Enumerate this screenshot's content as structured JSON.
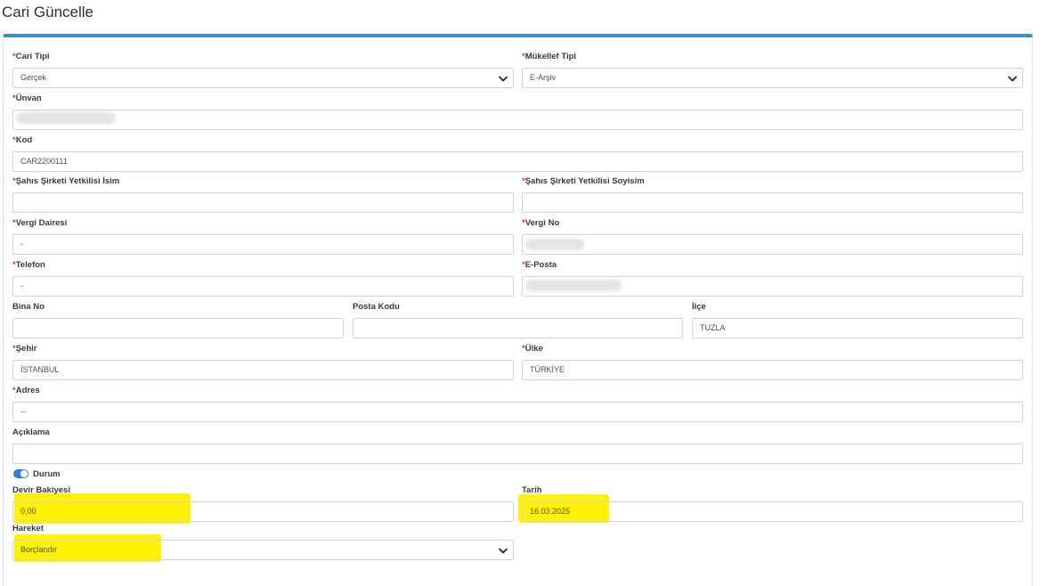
{
  "page": {
    "title": "Cari Güncelle"
  },
  "required_marker": "*",
  "form": {
    "cari_tipi": {
      "label": "Cari Tipi",
      "value": "Gerçek"
    },
    "mukellef_tipi": {
      "label": "Mükellef Tipi",
      "value": "E-Arşiv"
    },
    "unvan": {
      "label": "Ünvan",
      "value": ""
    },
    "kod": {
      "label": "Kod",
      "value": "CAR2200111"
    },
    "yetkili_isim": {
      "label": "Şahıs Şirketi Yetkilisi İsim",
      "value": ""
    },
    "yetkili_soyisim": {
      "label": "Şahıs Şirketi Yetkilisi Soyisim",
      "value": ""
    },
    "vergi_dairesi": {
      "label": "Vergi Dairesi",
      "value": "-"
    },
    "vergi_no": {
      "label": "Vergi No",
      "value": ""
    },
    "telefon": {
      "label": "Telefon",
      "value": "-"
    },
    "eposta": {
      "label": "E-Posta",
      "value": ""
    },
    "bina_no": {
      "label": "Bina No",
      "value": ""
    },
    "posta_kodu": {
      "label": "Posta Kodu",
      "value": ""
    },
    "ilce": {
      "label": "İlçe",
      "value": "TUZLA"
    },
    "sehir": {
      "label": "Şehir",
      "value": "İSTANBUL"
    },
    "ulke": {
      "label": "Ülke",
      "value": "TÜRKİYE"
    },
    "adres": {
      "label": "Adres",
      "value": "--"
    },
    "aciklama": {
      "label": "Açıklama",
      "value": ""
    },
    "durum": {
      "label": "Durum",
      "checked": true
    },
    "devir_bakiyesi": {
      "label": "Devir Bakiyesi",
      "value": "0,00"
    },
    "tarih": {
      "label": "Tarih",
      "value": "16.03.2025"
    },
    "hareket": {
      "label": "Hareket",
      "value": "Borçlandır"
    }
  },
  "colors": {
    "accent": "#3c8dbc",
    "required": "#dc3545",
    "toggle_on": "#2f7be0",
    "highlight": "#fff200"
  }
}
